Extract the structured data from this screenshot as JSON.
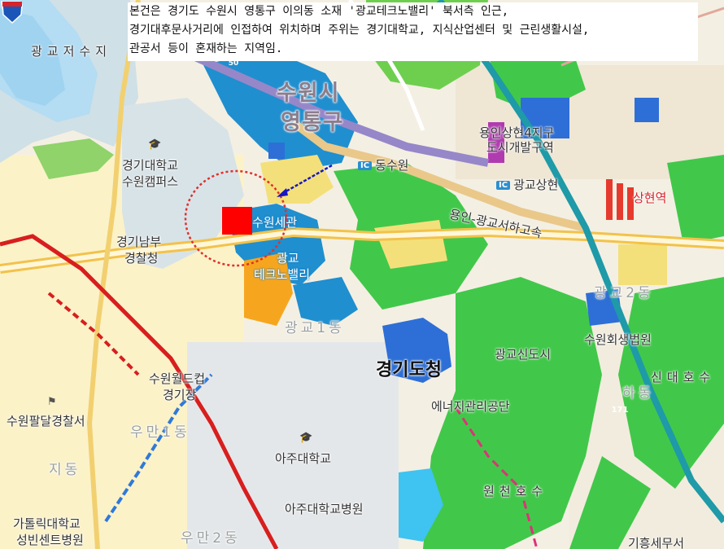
{
  "caption": {
    "lines": [
      "본건은 경기도 수원시 영통구 이의동 소재 '광교테크노밸리' 북서측 인근,",
      "경기대후문사거리에 인접하여 위치하며 주위는 경기대학교, 지식산업센터 및 근린생활시설,",
      "관공서 등이 혼재하는 지역임."
    ]
  },
  "labels": {
    "gwanggyo_reservoir": "광교저수지",
    "suwon_si": "수원시",
    "yeongtong_gu": "영통구",
    "kyonggi_univ": "경기대학교",
    "suwon_campus": "수원캠퍼스",
    "kyonggi_south_police": "경기남부",
    "police_station": "경찰청",
    "suwon_office": "수원세관",
    "gwanggyo": "광교",
    "technovalley": "테크노밸리",
    "dongsuwon_ic": "동수원",
    "gwanggyo_sanghyeon_ic": "광교상현",
    "yongin_sanghyeon": "용인상현4지구",
    "urban_dev": "도시개발구역",
    "sanghyeon_station": "상현역",
    "yongin_expressway": "용인-광교서하고속",
    "gwanggyo_dong_ghost": "광교1동",
    "gyeonggi_province_office": "경기도청",
    "gwanggyo_newtown": "광교신도시",
    "suwon_court": "수원회생법원",
    "sindaeho": "신대호수",
    "ha_ghost": "하동",
    "gwanggyo2_ghost": "광교2동",
    "suwon_worldcup_1": "수원월드컵",
    "suwon_worldcup_2": "경기장",
    "energy_agency": "에너지관리공단",
    "suwon_paldal_police": "수원팔달경찰서",
    "woman_ghost": "우만1동",
    "jidong_ghost": "지동",
    "ajou_univ": "아주대학교",
    "ajou_hospital": "아주대학교병원",
    "woncheon_lake": "원천호수",
    "catholic_univ": "가톨릭대학교",
    "st_vincent": "성빈센트병원",
    "woman2_ghost": "우만2동",
    "giheung_tax": "기흥세무서",
    "ic_badge": "IC"
  },
  "route_numbers": {
    "route_50": "50",
    "route_171": "171"
  },
  "colors": {
    "green_area": "#41c84a",
    "blue_water": "#1f8fcf",
    "subject_marker": "#ff0000",
    "radius_circle": "#e0302d",
    "arrow": "#1717c0",
    "rail": "#d81e1e"
  }
}
